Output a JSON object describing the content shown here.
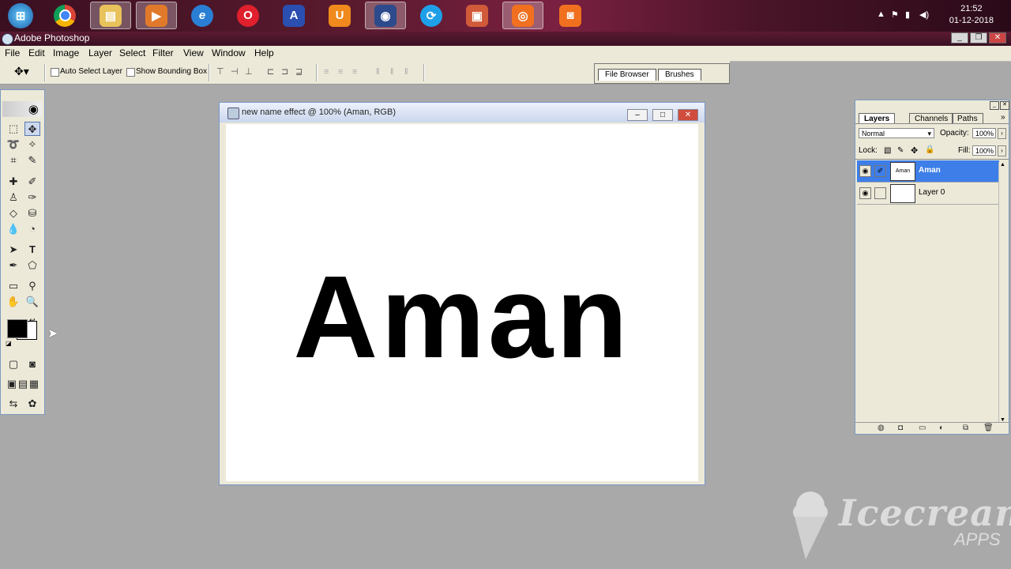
{
  "taskbar": {
    "clock_time": "21:52",
    "clock_date": "01-12-2018",
    "apps": [
      {
        "icon": "windows-start-icon"
      },
      {
        "icon": "chrome-icon"
      },
      {
        "icon": "file-explorer-icon"
      },
      {
        "icon": "media-player-icon"
      },
      {
        "icon": "internet-explorer-icon"
      },
      {
        "icon": "opera-icon"
      },
      {
        "icon": "app-a-icon"
      },
      {
        "icon": "uc-browser-icon"
      },
      {
        "icon": "photoshop-icon"
      },
      {
        "icon": "sync-icon"
      },
      {
        "icon": "presentation-icon"
      },
      {
        "icon": "screen-recorder-icon"
      },
      {
        "icon": "camera-icon"
      }
    ]
  },
  "app": {
    "title": "Adobe Photoshop"
  },
  "menu": [
    "File",
    "Edit",
    "Image",
    "Layer",
    "Select",
    "Filter",
    "View",
    "Window",
    "Help"
  ],
  "options": {
    "auto_select": "Auto Select Layer",
    "bounding_box": "Show Bounding Box"
  },
  "well": {
    "tabs": [
      "File Browser",
      "Brushes"
    ]
  },
  "document": {
    "title": "new name effect @ 100% (Aman, RGB)",
    "canvas_text": "Aman"
  },
  "layers_panel": {
    "tabs": [
      "Layers",
      "Channels",
      "Paths"
    ],
    "blend_mode": "Normal",
    "opacity_label": "Opacity:",
    "opacity": "100%",
    "lock_label": "Lock:",
    "fill_label": "Fill:",
    "fill": "100%",
    "layers": [
      {
        "name": "Aman",
        "thumb": "Aman",
        "selected": true
      },
      {
        "name": "Layer 0",
        "thumb": "",
        "selected": false
      }
    ]
  },
  "watermark": {
    "brand": "Icecream",
    "sub": "APPS"
  },
  "colors": {
    "selection": "#3d7ee8",
    "canvas": "#ffffff",
    "workspace": "#a9a9a9"
  }
}
